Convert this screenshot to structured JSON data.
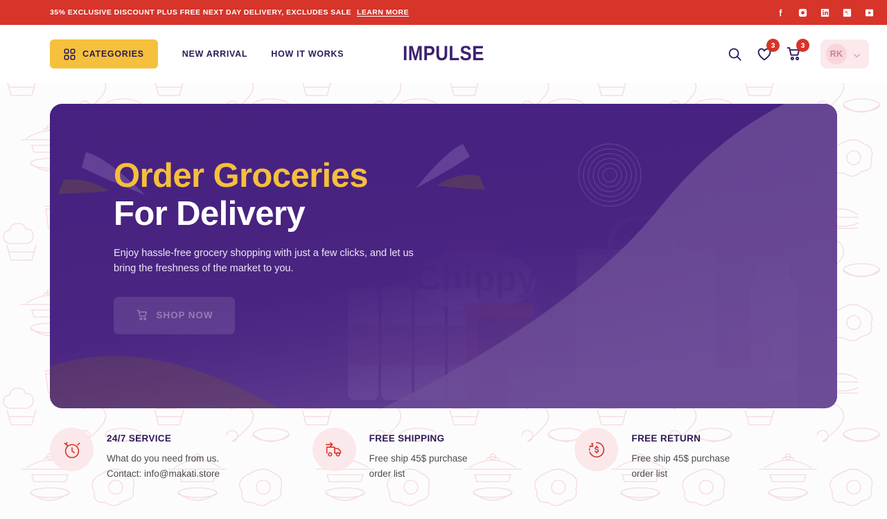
{
  "announcement": {
    "text": "35% EXCLUSIVE DISCOUNT PLUS FREE NEXT DAY DELIVERY, EXCLUDES SALE",
    "link_label": "LEARN MORE",
    "bg_color": "#d7342a",
    "socials": [
      {
        "name": "facebook-icon",
        "label": "Facebook"
      },
      {
        "name": "instagram-icon",
        "label": "Instagram"
      },
      {
        "name": "linkedin-icon",
        "label": "LinkedIn"
      },
      {
        "name": "blogger-icon",
        "label": "Blogger"
      },
      {
        "name": "youtube-icon",
        "label": "YouTube"
      }
    ]
  },
  "header": {
    "categories_label": "CATEGORIES",
    "categories_bg": "#f5c13c",
    "nav": [
      {
        "label": "NEW ARRIVAL"
      },
      {
        "label": "HOW IT WORKS"
      }
    ],
    "logo": "IMPULSE",
    "logo_color": "#3c2170",
    "wishlist_count": "3",
    "cart_count": "3",
    "badge_color": "#d7342a",
    "user_initials": "RK"
  },
  "hero": {
    "title_line1": "Order Groceries",
    "title_line2": "For Delivery",
    "title_line1_color": "#f5bf3c",
    "title_line2_color": "#ffffff",
    "subtitle": "Enjoy hassle-free grocery shopping with just a few clicks, and let us bring the freshness of the market to you.",
    "cta_label": "SHOP NOW",
    "bg_color": "#47217f"
  },
  "features": [
    {
      "icon": "alarm-clock-icon",
      "title": "24/7 SERVICE",
      "line1": "What do you need from us.",
      "line2": "Contact: info@makati.store"
    },
    {
      "icon": "delivery-truck-icon",
      "title": "FREE SHIPPING",
      "line1": "Free ship 45$ purchase",
      "line2": "order list"
    },
    {
      "icon": "refund-dollar-icon",
      "title": "FREE RETURN",
      "line1": "Free ship 45$ purchase",
      "line2": "order list"
    }
  ]
}
